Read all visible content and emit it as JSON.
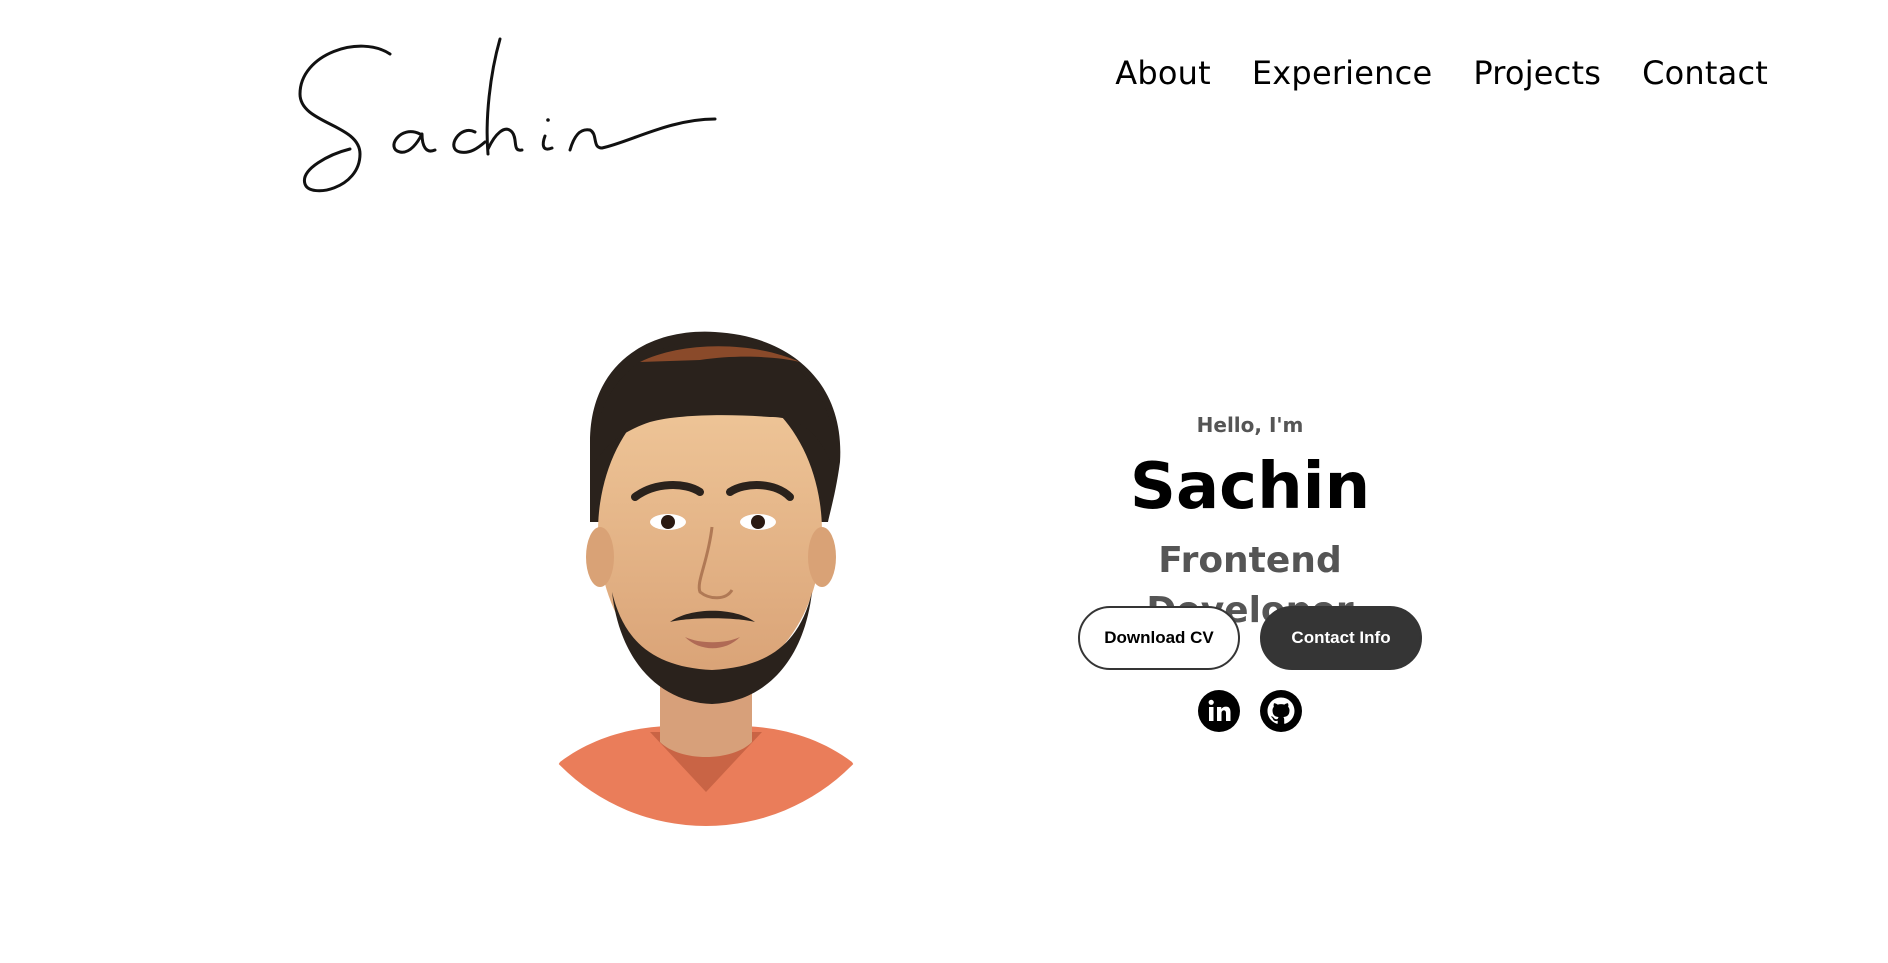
{
  "logo": {
    "text": "Sachin"
  },
  "nav": {
    "items": [
      {
        "label": "About"
      },
      {
        "label": "Experience"
      },
      {
        "label": "Projects"
      },
      {
        "label": "Contact"
      }
    ]
  },
  "profile": {
    "greeting": "Hello, I'm",
    "name": "Sachin",
    "role": "Frontend Developer"
  },
  "buttons": {
    "download_cv": "Download CV",
    "contact_info": "Contact Info"
  },
  "socials": [
    {
      "icon": "linkedin-icon"
    },
    {
      "icon": "github-icon"
    }
  ],
  "colors": {
    "text_primary": "#000000",
    "text_secondary": "#555555",
    "button_dark": "#353535",
    "background": "#ffffff"
  }
}
